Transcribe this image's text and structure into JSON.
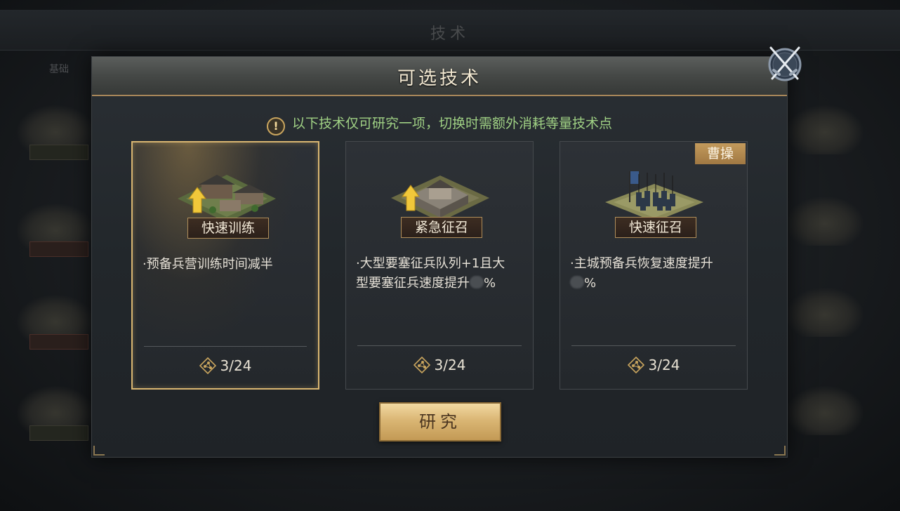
{
  "background": {
    "title": "技术",
    "tab": "基础",
    "node_labels": [
      "",
      "",
      "",
      ""
    ]
  },
  "modal": {
    "title": "可选技术",
    "notice": "以下技术仅可研究一项，切换时需额外消耗等量技术点",
    "notice_icon": "!",
    "research_label": "研究",
    "close_icon": "close-crossed-swords-icon"
  },
  "cards": [
    {
      "name": "快速训练",
      "desc_lines": [
        "·预备兵营训练时间减半"
      ],
      "points": "3/24",
      "badge": "",
      "selected": true,
      "art": "barracks-upgrade-icon"
    },
    {
      "name": "紧急征召",
      "desc_lines": [
        "·大型要塞征兵队列+1且大",
        "型要塞征兵速度提升"
      ],
      "desc_suffix": "%",
      "points": "3/24",
      "badge": "",
      "selected": false,
      "art": "fortress-upgrade-icon"
    },
    {
      "name": "快速征召",
      "desc_lines": [
        "·主城预备兵恢复速度提升"
      ],
      "desc_suffix": "%",
      "points": "3/24",
      "badge": "曹操",
      "selected": false,
      "art": "army-troops-icon"
    }
  ],
  "colors": {
    "accent_gold": "#d9b671",
    "notice_green": "#9fd084",
    "button_gold": "#dab674"
  }
}
